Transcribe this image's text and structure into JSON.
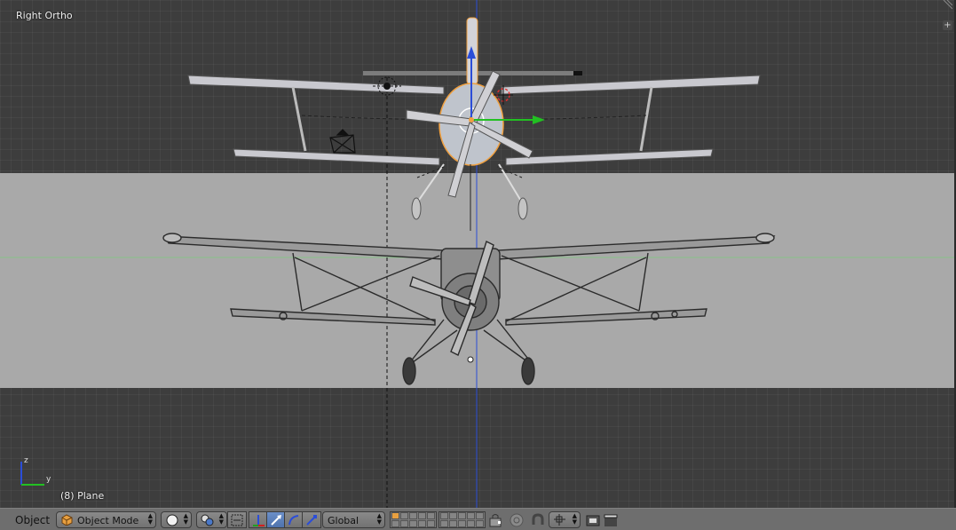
{
  "viewport": {
    "view_name": "Right Ortho",
    "active_object": "(8) Plane",
    "axis_labels": {
      "up": "z",
      "side": "y"
    },
    "colors": {
      "grid_bg": "#3d3d3d",
      "reference_image": "#a9a9a9",
      "axis_green": "#7ec87e",
      "axis_blue": "#2b4dd8",
      "selection_orange": "#f0a040"
    }
  },
  "header": {
    "object_menu": "Object",
    "mode": "Object Mode",
    "orientation": "Global",
    "icons": [
      "cube-mode-icon",
      "shading-solid-icon",
      "pivot-icon",
      "manipulator-toggle-icon",
      "translate-icon",
      "rotate-icon",
      "scale-icon",
      "lock-icon",
      "proportional-icon",
      "snap-magnet-icon",
      "snap-target-icon",
      "render-icon",
      "clapper-icon"
    ]
  }
}
